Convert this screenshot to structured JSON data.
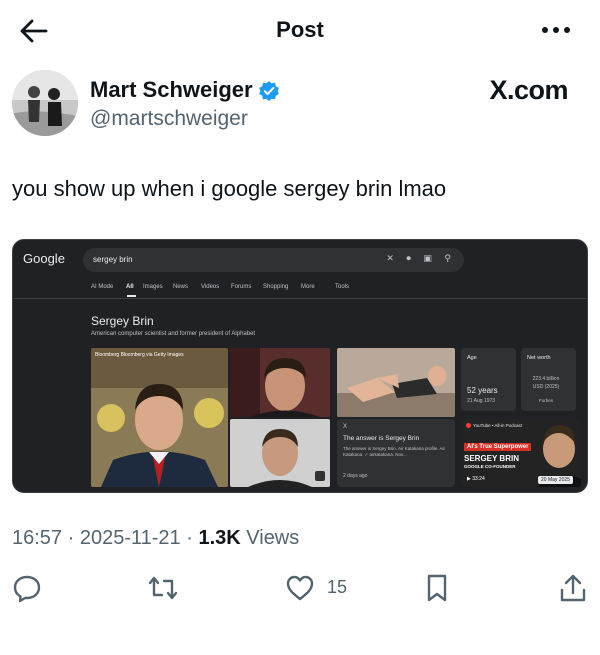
{
  "header": {
    "title": "Post",
    "back_icon": "arrow-left-icon",
    "more_icon": "more-horizontal-icon"
  },
  "author": {
    "name": "Mart Schweiger",
    "handle": "@martschweiger",
    "verified_color": "#1d9bf0"
  },
  "site_label": "X.com",
  "tweet": {
    "text": "you show up when i google sergey brin lmao"
  },
  "media": {
    "google": {
      "logo": "Google",
      "query": "sergey brin",
      "tabs": [
        "AI Mode",
        "All",
        "Images",
        "News",
        "Videos",
        "Forums",
        "Shopping",
        "More",
        "Tools"
      ],
      "active_tab": "All",
      "knowledge_title": "Sergey Brin",
      "knowledge_desc": "American computer scientist and former president of Alphabet",
      "photo_caption": "Bloomberg Bloomberg via Getty Images",
      "answer": {
        "source": "X",
        "title": "The answer is Sergey Brin",
        "body": "The answer is Sergey Brin. Air Katakana profile. Air Katakana. ✓ airkatakana. Nov...",
        "time": "2 days ago"
      },
      "age": {
        "label": "Age",
        "value": "52 years",
        "sub": "21 Aug 1973"
      },
      "net_worth": {
        "label": "Net worth",
        "line1": "223.4 billion",
        "line2": "USD (2025)",
        "source": "Forbes"
      },
      "video": {
        "source": "YouTube • All-in Podcast",
        "red_text": "AI's True Superpower",
        "title": "SERGEY BRIN",
        "subtitle": "GOOGLE CO-FOUNDER",
        "duration": "33:24",
        "date": "20 May 2025"
      }
    }
  },
  "meta": {
    "time": "16:57",
    "date": "2025-11-21",
    "views_count": "1.3K",
    "views_label": "Views"
  },
  "actions": {
    "reply_icon": "reply-icon",
    "repost_icon": "repost-icon",
    "like_icon": "heart-icon",
    "like_count": "15",
    "bookmark_icon": "bookmark-icon",
    "share_icon": "share-icon"
  }
}
